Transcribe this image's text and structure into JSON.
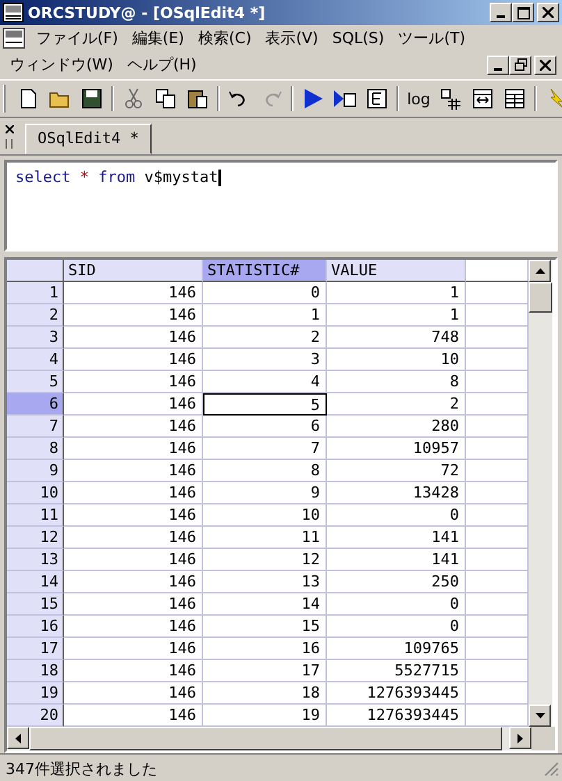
{
  "window": {
    "title": "ORCSTUDY@ - [OSqlEdit4 *]"
  },
  "menu": [
    {
      "label": "ファイル(F)"
    },
    {
      "label": "編集(E)"
    },
    {
      "label": "検索(C)"
    },
    {
      "label": "表示(V)"
    },
    {
      "label": "SQL(S)"
    },
    {
      "label": "ツール(T)"
    },
    {
      "label": "ウィンドウ(W)"
    },
    {
      "label": "ヘルプ(H)"
    }
  ],
  "toolbar": {
    "log_button": "log"
  },
  "tabs": [
    {
      "label": "OSqlEdit4 *",
      "selected": true
    }
  ],
  "editor": {
    "tokens": [
      {
        "text": "select",
        "kind": "keyword"
      },
      {
        "text": "*",
        "kind": "operator"
      },
      {
        "text": "from",
        "kind": "keyword"
      },
      {
        "text": "v$mystat",
        "kind": "name"
      }
    ]
  },
  "grid": {
    "columns": [
      {
        "label": "SID",
        "selected": false
      },
      {
        "label": "STATISTIC#",
        "selected": true
      },
      {
        "label": "VALUE",
        "selected": false
      }
    ],
    "rows": [
      {
        "num": "1",
        "cells": [
          "146",
          "0",
          "1"
        ],
        "selected": false
      },
      {
        "num": "2",
        "cells": [
          "146",
          "1",
          "1"
        ],
        "selected": false
      },
      {
        "num": "3",
        "cells": [
          "146",
          "2",
          "748"
        ],
        "selected": false
      },
      {
        "num": "4",
        "cells": [
          "146",
          "3",
          "10"
        ],
        "selected": false
      },
      {
        "num": "5",
        "cells": [
          "146",
          "4",
          "8"
        ],
        "selected": false
      },
      {
        "num": "6",
        "cells": [
          "146",
          "5",
          "2"
        ],
        "selected": true
      },
      {
        "num": "7",
        "cells": [
          "146",
          "6",
          "280"
        ],
        "selected": false
      },
      {
        "num": "8",
        "cells": [
          "146",
          "7",
          "10957"
        ],
        "selected": false
      },
      {
        "num": "9",
        "cells": [
          "146",
          "8",
          "72"
        ],
        "selected": false
      },
      {
        "num": "10",
        "cells": [
          "146",
          "9",
          "13428"
        ],
        "selected": false
      },
      {
        "num": "11",
        "cells": [
          "146",
          "10",
          "0"
        ],
        "selected": false
      },
      {
        "num": "12",
        "cells": [
          "146",
          "11",
          "141"
        ],
        "selected": false
      },
      {
        "num": "13",
        "cells": [
          "146",
          "12",
          "141"
        ],
        "selected": false
      },
      {
        "num": "14",
        "cells": [
          "146",
          "13",
          "250"
        ],
        "selected": false
      },
      {
        "num": "15",
        "cells": [
          "146",
          "14",
          "0"
        ],
        "selected": false
      },
      {
        "num": "16",
        "cells": [
          "146",
          "15",
          "0"
        ],
        "selected": false
      },
      {
        "num": "17",
        "cells": [
          "146",
          "16",
          "109765"
        ],
        "selected": false
      },
      {
        "num": "18",
        "cells": [
          "146",
          "17",
          "5527715"
        ],
        "selected": false
      },
      {
        "num": "19",
        "cells": [
          "146",
          "18",
          "1276393445"
        ],
        "selected": false
      },
      {
        "num": "20",
        "cells": [
          "146",
          "19",
          "1276393445"
        ],
        "selected": false
      }
    ]
  },
  "status_bar": {
    "text": "347件選択されました"
  }
}
